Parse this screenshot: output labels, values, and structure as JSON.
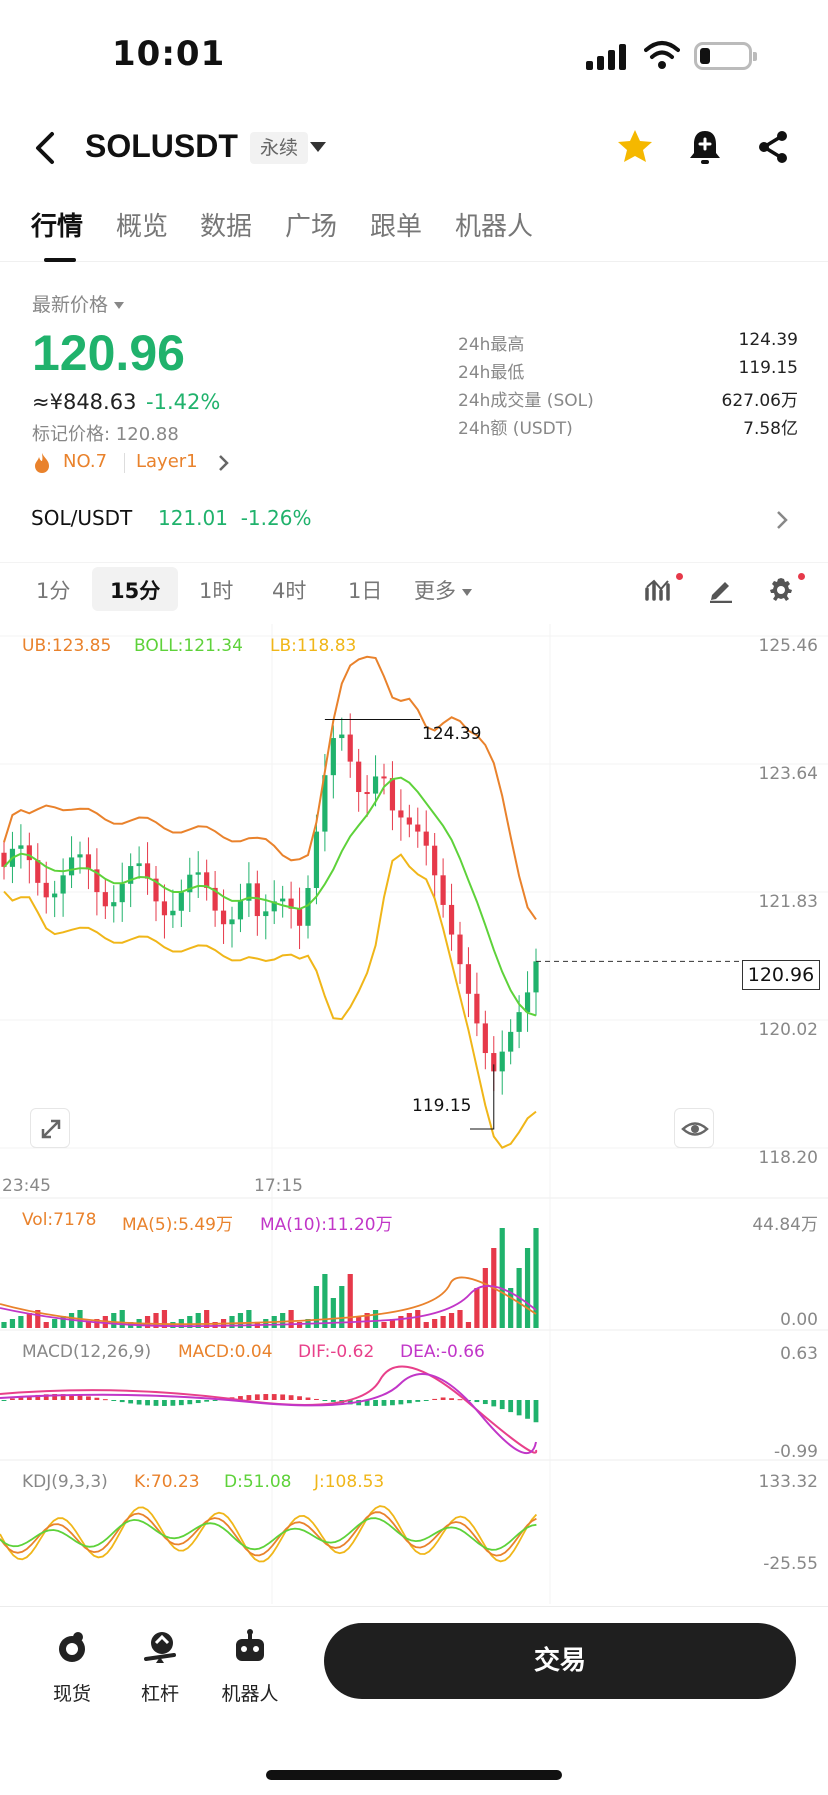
{
  "status_bar": {
    "time": "10:01"
  },
  "header": {
    "pair": "SOLUSDT",
    "contract_tag": "永续"
  },
  "tabs": [
    "行情",
    "概览",
    "数据",
    "广场",
    "跟单",
    "机器人"
  ],
  "price": {
    "label": "最新价格",
    "last": "120.96",
    "cny": "≈¥848.63",
    "change": "-1.42%",
    "mark": "标记价格: 120.88",
    "rank": "NO.7",
    "category": "Layer1"
  },
  "stats": [
    {
      "label": "24h最高",
      "value": "124.39"
    },
    {
      "label": "24h最低",
      "value": "119.15"
    },
    {
      "label": "24h成交量 (SOL)",
      "value": "627.06万"
    },
    {
      "label": "24h额 (USDT)",
      "value": "7.58亿"
    }
  ],
  "spot": {
    "pair": "SOL/USDT",
    "price": "121.01",
    "change": "-1.26%"
  },
  "intervals": {
    "items": [
      "1分",
      "15分",
      "1时",
      "4时",
      "1日"
    ],
    "more": "更多",
    "active": "15分"
  },
  "chart": {
    "boll_legend": {
      "ub": "UB:123.85",
      "boll": "BOLL:121.34",
      "lb": "LB:118.83"
    },
    "price_axis": [
      "125.46",
      "123.64",
      "121.83",
      "120.02",
      "118.20"
    ],
    "current_tag": "120.96",
    "high_label": "124.39",
    "low_label": "119.15",
    "time_axis": [
      "23:45",
      "17:15"
    ],
    "vol_legend": {
      "vol": "Vol:7178",
      "ma5": "MA(5):5.49万",
      "ma10": "MA(10):11.20万"
    },
    "vol_axis": [
      "44.84万",
      "0.00"
    ],
    "macd_legend": {
      "title": "MACD(12,26,9)",
      "macd": "MACD:0.04",
      "dif": "DIF:-0.62",
      "dea": "DEA:-0.66"
    },
    "macd_axis": [
      "0.63",
      "-0.99"
    ],
    "kdj_legend": {
      "title": "KDJ(9,3,3)",
      "k": "K:70.23",
      "d": "D:51.08",
      "j": "J:108.53"
    },
    "kdj_axis": [
      "133.32",
      "-25.55"
    ]
  },
  "colors": {
    "up": "#20b26c",
    "down": "#e6394a",
    "ub": "#e9822c",
    "boll": "#5ed23a",
    "lb": "#f0b619",
    "ma10": "#c136c8",
    "macd_dif": "#e8408a",
    "accent_star": "#f5b800"
  },
  "bottom_nav": [
    {
      "label": "现货",
      "icon": "spot-icon"
    },
    {
      "label": "杠杆",
      "icon": "margin-icon"
    },
    {
      "label": "机器人",
      "icon": "robot-icon"
    }
  ],
  "trade_button": "交易"
}
